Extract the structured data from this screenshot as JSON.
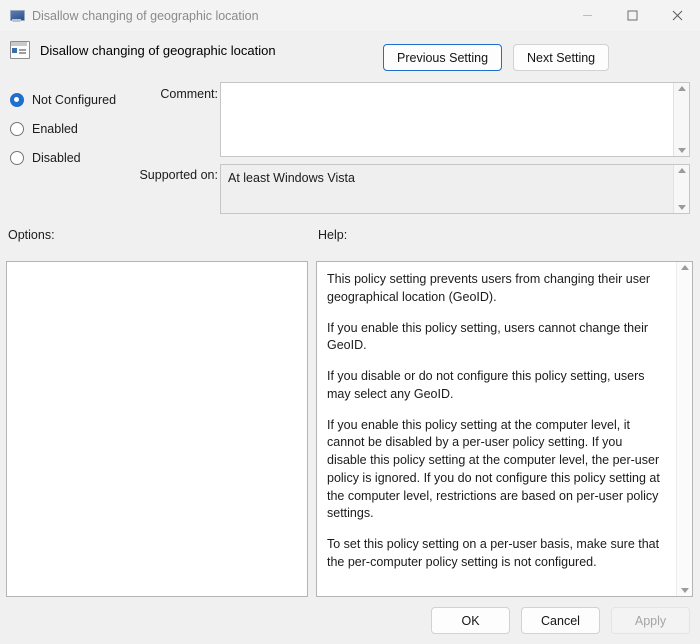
{
  "window": {
    "title": "Disallow changing of geographic location",
    "title_icon": "monitor-icon",
    "controls": {
      "minimize": "minimize-icon",
      "maximize": "maximize-icon",
      "close": "close-icon"
    }
  },
  "header": {
    "icon": "policy-setting-icon",
    "title": "Disallow changing of geographic location",
    "previous_setting": "Previous Setting",
    "next_setting": "Next Setting"
  },
  "state_options": [
    {
      "label": "Not Configured",
      "checked": true
    },
    {
      "label": "Enabled",
      "checked": false
    },
    {
      "label": "Disabled",
      "checked": false
    }
  ],
  "comment": {
    "label": "Comment:",
    "value": ""
  },
  "supported_on": {
    "label": "Supported on:",
    "value": "At least Windows Vista"
  },
  "options": {
    "label": "Options:",
    "content": ""
  },
  "help": {
    "label": "Help:",
    "paragraphs": [
      "This policy setting prevents users from changing their user geographical location (GeoID).",
      "If you enable this policy setting, users cannot change their GeoID.",
      "If you disable or do not configure this policy setting, users may select any GeoID.",
      "If you enable this policy setting at the computer level, it cannot be disabled by a per-user policy setting. If you disable this policy setting at the computer level, the per-user policy is ignored. If you do not configure this policy setting at the computer level, restrictions are based on per-user policy settings.",
      "To set this policy setting on a per-user basis, make sure that the per-computer policy setting is not configured."
    ]
  },
  "footer": {
    "ok": "OK",
    "cancel": "Cancel",
    "apply": "Apply",
    "apply_disabled": true
  },
  "colors": {
    "accent": "#1f6fd0",
    "window_bg": "#f0f0f0",
    "panel_border": "#b4b4b4",
    "title_text": "#8b8b8b"
  }
}
